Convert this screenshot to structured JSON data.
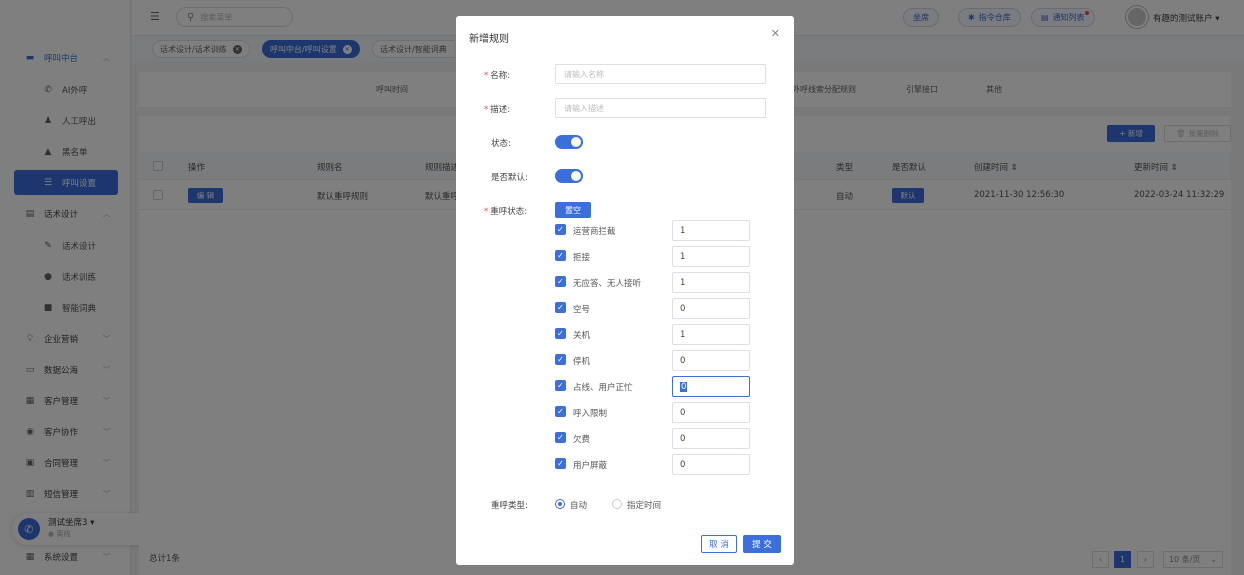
{
  "sidebar": {
    "items": [
      {
        "label": "呼叫中台",
        "icon": "monitor-icon"
      },
      {
        "label": "AI外呼",
        "icon": "phone-icon"
      },
      {
        "label": "人工呼出",
        "icon": "user-icon"
      },
      {
        "label": "黑名单",
        "icon": "warning-icon"
      },
      {
        "label": "呼叫设置",
        "icon": "sliders-icon"
      },
      {
        "label": "话术设计",
        "icon": "document-icon"
      },
      {
        "label": "话术设计",
        "icon": "pen-icon"
      },
      {
        "label": "话术训练",
        "icon": "chat-icon"
      },
      {
        "label": "智能词典",
        "icon": "book-icon"
      },
      {
        "label": "企业营销",
        "icon": "bulb-icon"
      },
      {
        "label": "数据公海",
        "icon": "database-icon"
      },
      {
        "label": "客户管理",
        "icon": "id-card-icon"
      },
      {
        "label": "客户协作",
        "icon": "team-icon"
      },
      {
        "label": "合同管理",
        "icon": "contract-icon"
      },
      {
        "label": "短信管理",
        "icon": "sms-icon"
      },
      {
        "label": "系统设置",
        "icon": "grid-icon"
      }
    ],
    "phone_user": "测试坐席3",
    "phone_status": "离线"
  },
  "topbar": {
    "search_placeholder": "搜索菜单",
    "seat_btn": "坐席",
    "cmd_btn": "指令仓库",
    "notice_btn": "通知列表",
    "account": "有趣的测试账户"
  },
  "tabs": [
    {
      "label": "话术设计/话术训练"
    },
    {
      "label": "呼叫中台/呼叫设置"
    },
    {
      "label": "话术设计/智能词典"
    }
  ],
  "subtabs": [
    "呼叫时间",
    "外呼线索分配规则",
    "引擎接口",
    "其他"
  ],
  "toolbar": {
    "add": "+ 新增",
    "batch_delete": "批量删除"
  },
  "table": {
    "headers": [
      "操作",
      "规则名",
      "规则描述",
      "类型",
      "是否默认",
      "创建时间 ⇕",
      "更新时间 ⇕"
    ],
    "rows": [
      {
        "op": "编 辑",
        "name": "默认重呼规则",
        "desc": "默认重呼",
        "type": "自动",
        "default": "默认",
        "created": "2021-11-30 12:56:30",
        "updated": "2022-03-24 11:32:29"
      }
    ],
    "total": "总计1条",
    "page": "1",
    "page_size": "10 条/页"
  },
  "modal": {
    "title": "新增规则",
    "name_label": "名称:",
    "name_placeholder": "请输入名称",
    "desc_label": "描述:",
    "desc_placeholder": "请输入描述",
    "status_label": "状态:",
    "default_label": "是否默认:",
    "recall_label": "重呼状态:",
    "clear_btn": "置空",
    "statuses": [
      {
        "label": "运营商拦截",
        "value": "1"
      },
      {
        "label": "拒接",
        "value": "1"
      },
      {
        "label": "无应答、无人接听",
        "value": "1"
      },
      {
        "label": "空号",
        "value": "0"
      },
      {
        "label": "关机",
        "value": "1"
      },
      {
        "label": "停机",
        "value": "0"
      },
      {
        "label": "占线、用户正忙",
        "value": "0"
      },
      {
        "label": "呼入限制",
        "value": "0"
      },
      {
        "label": "欠费",
        "value": "0"
      },
      {
        "label": "用户屏蔽",
        "value": "0"
      }
    ],
    "type_label": "重呼类型:",
    "type_auto": "自动",
    "type_time": "指定时间",
    "cancel": "取 消",
    "submit": "提 交"
  },
  "colors": {
    "accent": "#3a6fdc",
    "required": "#e74c3c"
  }
}
